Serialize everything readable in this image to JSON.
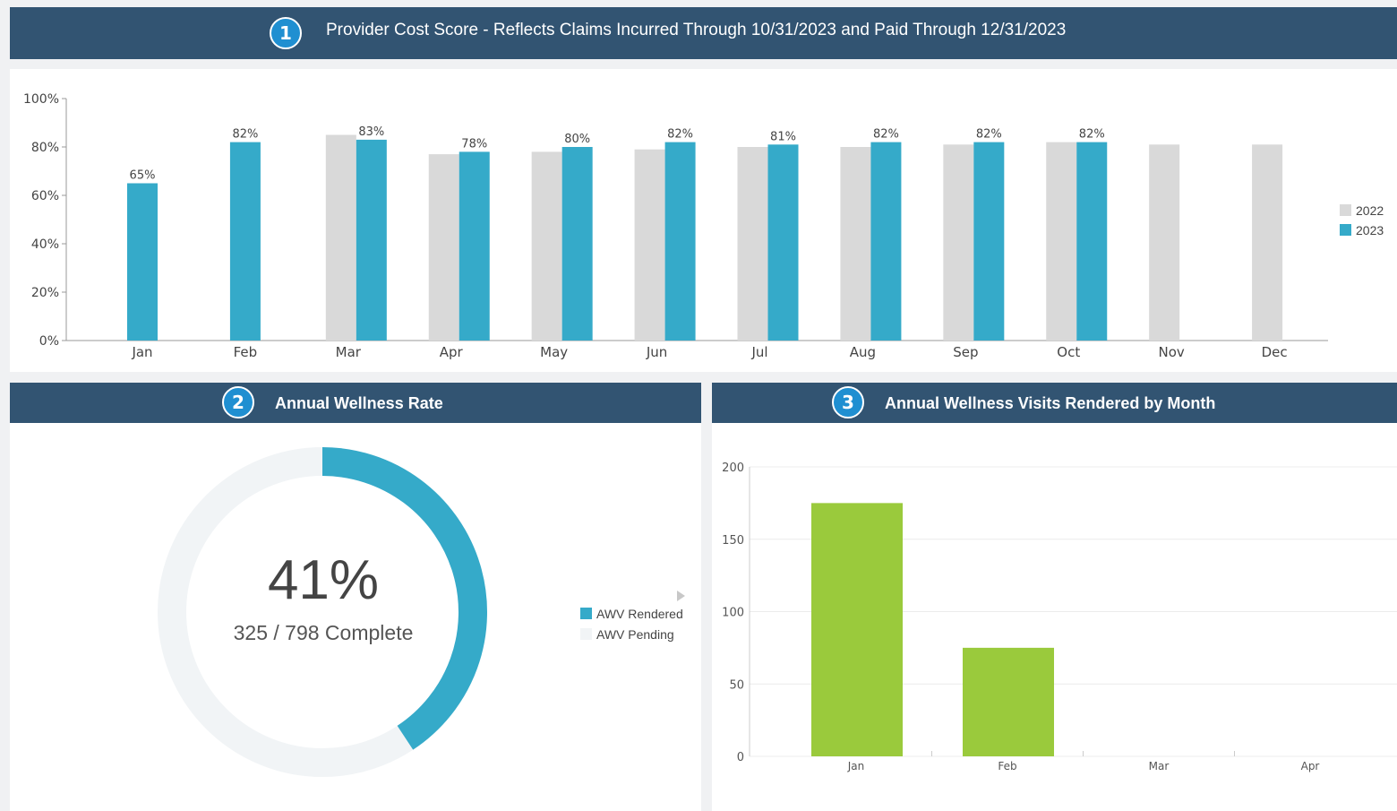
{
  "panel1": {
    "badge": "1",
    "title": "Provider Cost Score - Reflects Claims Incurred Through 10/31/2023 and Paid Through 12/31/2023"
  },
  "panel2": {
    "badge": "2",
    "title": "Annual Wellness Rate",
    "big_value": "41%",
    "sub_value": "325 / 798 Complete",
    "legend": [
      {
        "label": "AWV Rendered",
        "color": "#35aac9"
      },
      {
        "label": "AWV Pending",
        "color": "#f1f4f6"
      }
    ]
  },
  "panel3": {
    "badge": "3",
    "title": "Annual Wellness Visits Rendered by Month"
  },
  "chart_data": [
    {
      "type": "bar",
      "categories": [
        "Jan",
        "Feb",
        "Mar",
        "Apr",
        "May",
        "Jun",
        "Jul",
        "Aug",
        "Sep",
        "Oct",
        "Nov",
        "Dec"
      ],
      "series": [
        {
          "name": "2022",
          "color": "#d9d9d9",
          "values": [
            null,
            null,
            85,
            77,
            78,
            79,
            80,
            80,
            81,
            82,
            81,
            81
          ]
        },
        {
          "name": "2023",
          "color": "#35aac9",
          "values": [
            65,
            82,
            83,
            78,
            80,
            82,
            81,
            82,
            82,
            82,
            null,
            null
          ],
          "labels": [
            "65%",
            "82%",
            "83%",
            "78%",
            "80%",
            "82%",
            "81%",
            "82%",
            "82%",
            "82%",
            "",
            ""
          ]
        }
      ],
      "y_ticks": [
        "0%",
        "20%",
        "40%",
        "60%",
        "80%",
        "100%"
      ],
      "ylim": [
        0,
        100
      ],
      "legend_position": "right"
    },
    {
      "type": "pie",
      "slices": [
        {
          "name": "AWV Rendered",
          "value": 325,
          "color": "#35aac9"
        },
        {
          "name": "AWV Pending",
          "value": 473,
          "color": "#f1f4f6"
        }
      ],
      "donut": true
    },
    {
      "type": "bar",
      "categories": [
        "Jan",
        "Feb",
        "Mar",
        "Apr"
      ],
      "series": [
        {
          "color": "#9aca3c",
          "values": [
            175,
            75,
            0,
            0
          ]
        }
      ],
      "y_ticks": [
        "0",
        "50",
        "100",
        "150",
        "200"
      ],
      "ylim": [
        0,
        200
      ],
      "grid": true
    }
  ]
}
